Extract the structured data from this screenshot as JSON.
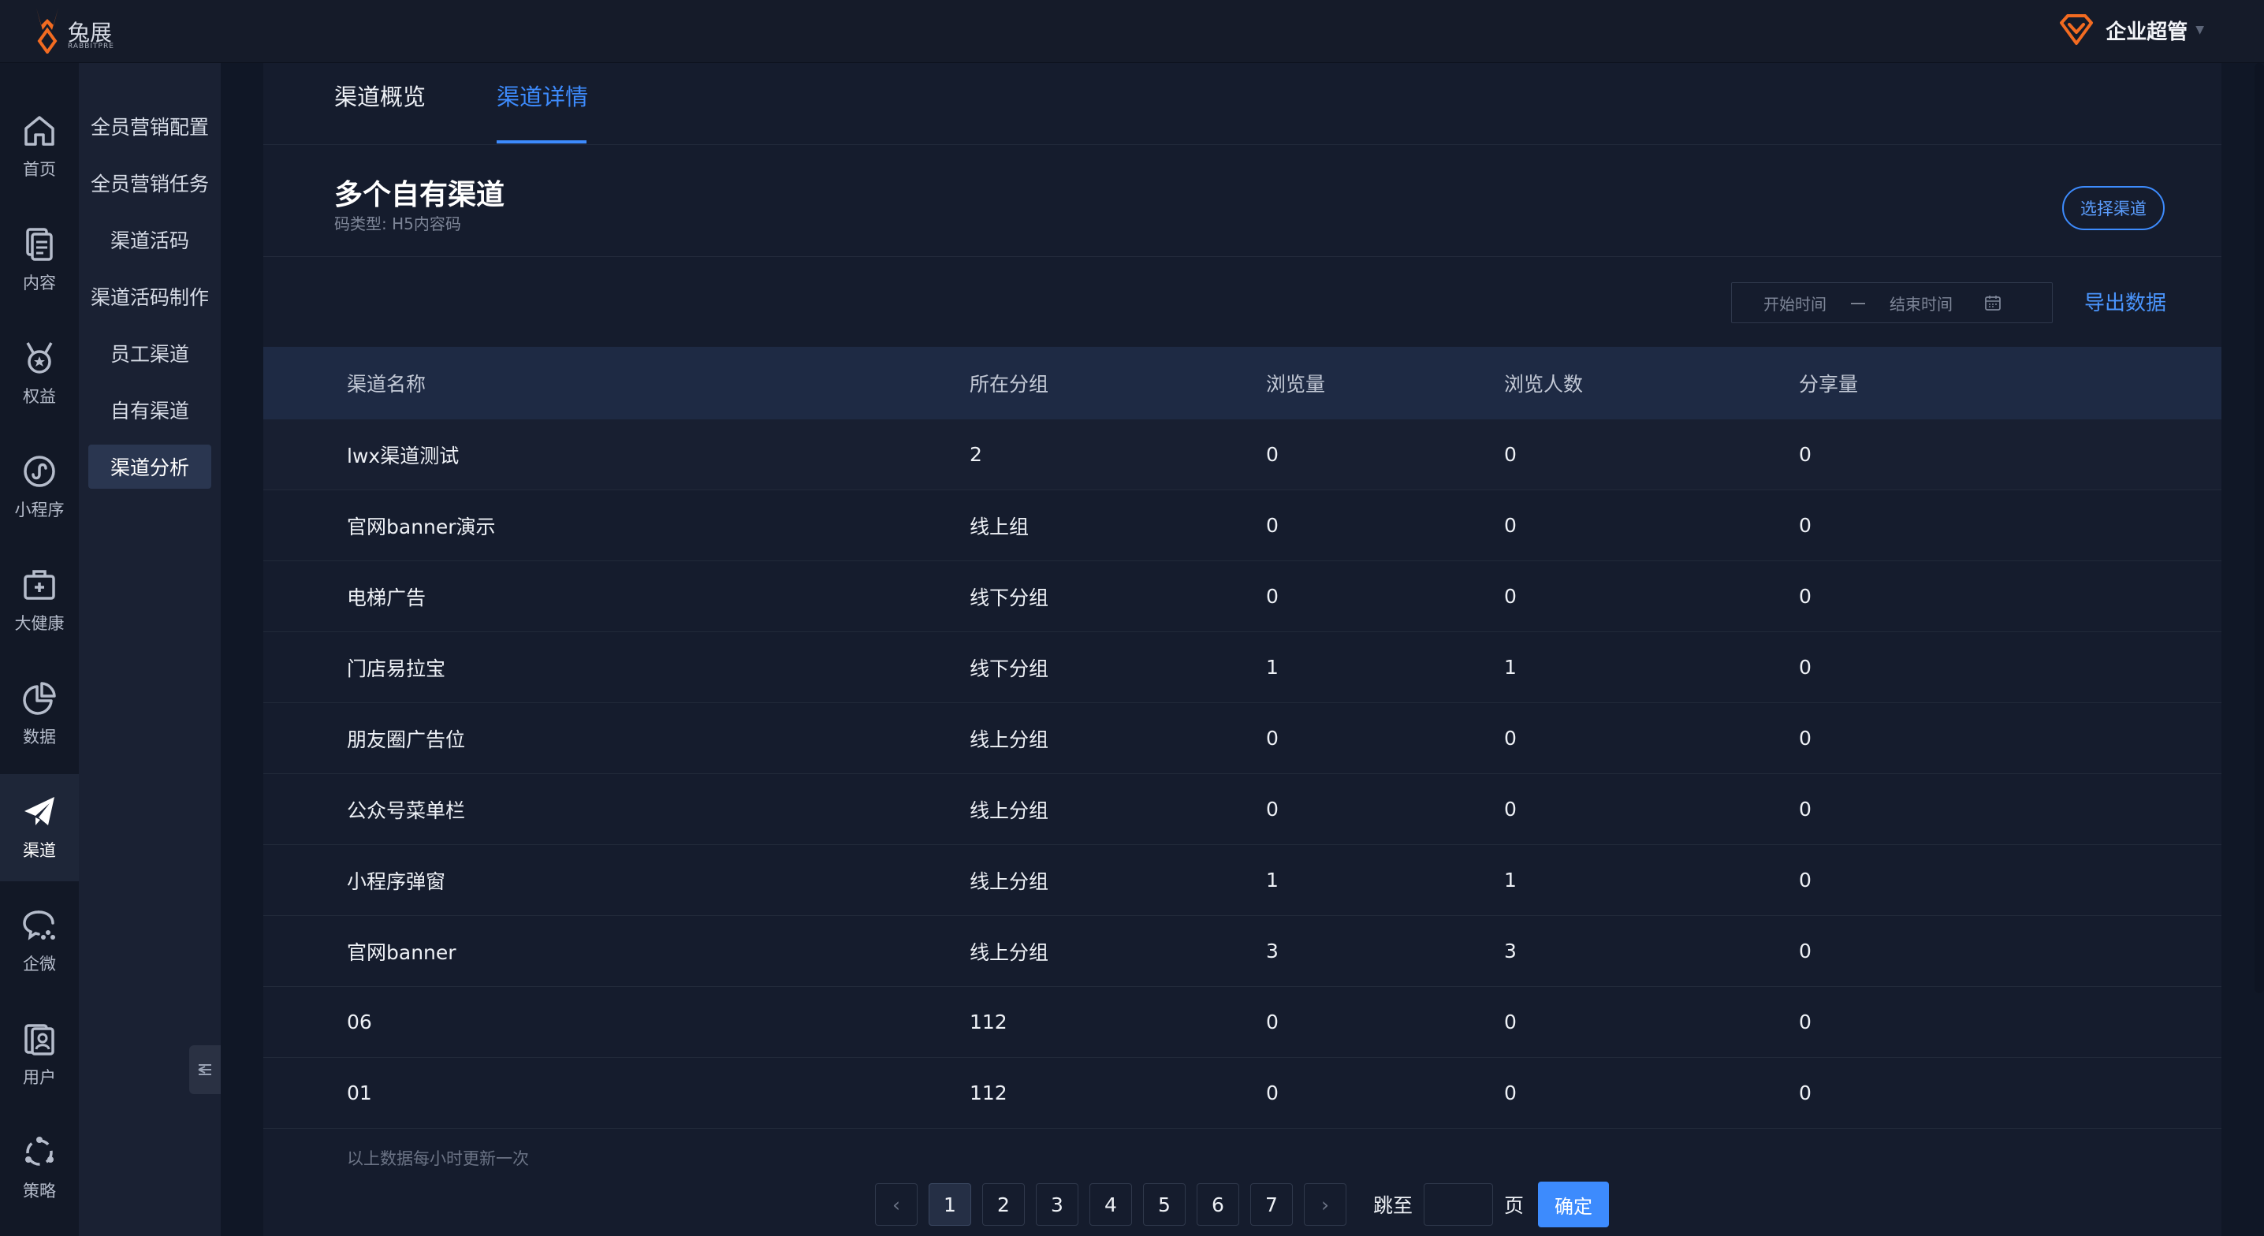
{
  "header": {
    "brand": "兔展",
    "brand_sub": "RABBITPRE",
    "user_role": "企业超管"
  },
  "rail": [
    {
      "label": "首页",
      "icon": "home-icon"
    },
    {
      "label": "内容",
      "icon": "content-icon"
    },
    {
      "label": "权益",
      "icon": "medal-icon"
    },
    {
      "label": "小程序",
      "icon": "miniprogram-icon"
    },
    {
      "label": "大健康",
      "icon": "health-icon"
    },
    {
      "label": "数据",
      "icon": "pie-chart-icon"
    },
    {
      "label": "渠道",
      "icon": "paper-plane-icon"
    },
    {
      "label": "企微",
      "icon": "chat-icon"
    },
    {
      "label": "用户",
      "icon": "user-card-icon"
    },
    {
      "label": "策略",
      "icon": "strategy-icon"
    }
  ],
  "submenu": [
    {
      "label": "全员营销配置"
    },
    {
      "label": "全员营销任务"
    },
    {
      "label": "渠道活码"
    },
    {
      "label": "渠道活码制作"
    },
    {
      "label": "员工渠道"
    },
    {
      "label": "自有渠道"
    },
    {
      "label": "渠道分析"
    }
  ],
  "tabs": [
    {
      "label": "渠道概览"
    },
    {
      "label": "渠道详情"
    }
  ],
  "page": {
    "title": "多个自有渠道",
    "subtitle": "码类型: H5内容码",
    "select_channel": "选择渠道"
  },
  "filter": {
    "start_placeholder": "开始时间",
    "dash": "—",
    "end_placeholder": "结束时间",
    "export": "导出数据"
  },
  "table": {
    "columns": [
      "渠道名称",
      "所在分组",
      "浏览量",
      "浏览人数",
      "分享量"
    ],
    "rows": [
      [
        "lwx渠道测试",
        "2",
        "0",
        "0",
        "0"
      ],
      [
        "官网banner演示",
        "线上组",
        "0",
        "0",
        "0"
      ],
      [
        "电梯广告",
        "线下分组",
        "0",
        "0",
        "0"
      ],
      [
        "门店易拉宝",
        "线下分组",
        "1",
        "1",
        "0"
      ],
      [
        "朋友圈广告位",
        "线上分组",
        "0",
        "0",
        "0"
      ],
      [
        "公众号菜单栏",
        "线上分组",
        "0",
        "0",
        "0"
      ],
      [
        "小程序弹窗",
        "线上分组",
        "1",
        "1",
        "0"
      ],
      [
        "官网banner",
        "线上分组",
        "3",
        "3",
        "0"
      ],
      [
        "06",
        "112",
        "0",
        "0",
        "0"
      ],
      [
        "01",
        "112",
        "0",
        "0",
        "0"
      ]
    ],
    "footnote": "以上数据每小时更新一次"
  },
  "pagination": {
    "prev": "‹",
    "pages": [
      "1",
      "2",
      "3",
      "4",
      "5",
      "6",
      "7"
    ],
    "current_page": 1,
    "next": "›",
    "jump_label": "跳至",
    "page_unit": "页",
    "confirm": "确定"
  },
  "colors": {
    "accent": "#3d8bfd",
    "background": "#101726",
    "panel": "#151c2d",
    "logo_orange": "#f26b21"
  }
}
